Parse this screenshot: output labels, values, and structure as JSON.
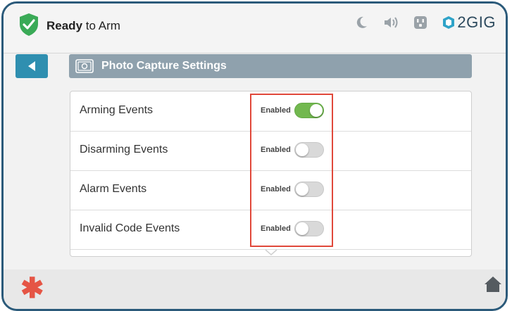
{
  "header": {
    "status_bold": "Ready",
    "status_rest": "to Arm",
    "brand_text": "2GIG",
    "icons": [
      "shield-check-icon",
      "moon-icon",
      "speaker-icon",
      "power-outlet-icon",
      "2gig-logo-icon"
    ]
  },
  "nav": {
    "back_icon": "back-arrow-icon"
  },
  "page": {
    "title": "Photo Capture Settings",
    "title_icon": "camera-icon"
  },
  "settings": [
    {
      "label": "Arming Events",
      "state_label": "Enabled",
      "enabled": true
    },
    {
      "label": "Disarming Events",
      "state_label": "Enabled",
      "enabled": false
    },
    {
      "label": "Alarm Events",
      "state_label": "Enabled",
      "enabled": false
    },
    {
      "label": "Invalid Code Events",
      "state_label": "Enabled",
      "enabled": false
    }
  ],
  "footer": {
    "icons": [
      "emergency-asterisk-icon",
      "home-icon"
    ]
  },
  "colors": {
    "accent": "#2f8fb0",
    "toggle_on": "#72b84f",
    "highlight": "#e0483a",
    "shield": "#3aaa57",
    "emergency": "#e55545"
  }
}
